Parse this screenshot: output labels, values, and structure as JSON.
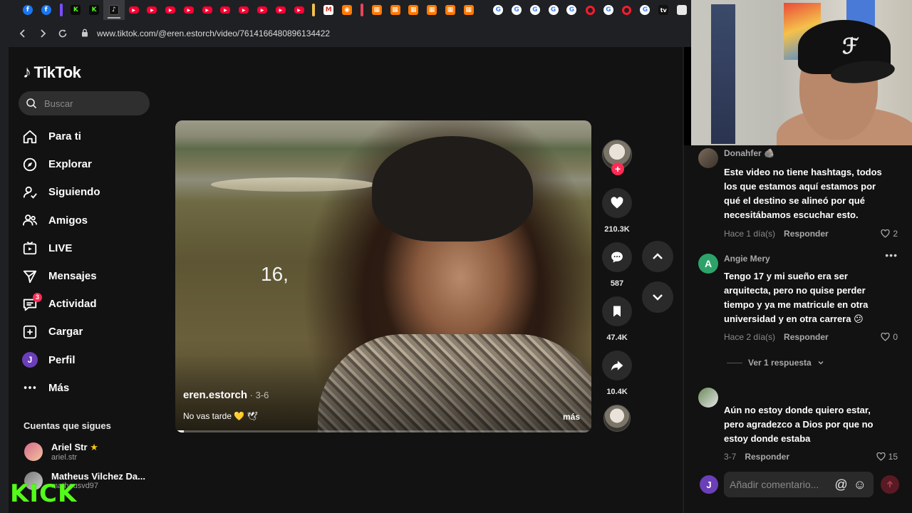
{
  "browser": {
    "url": "www.tiktok.com/@eren.estorch/video/7614166480896134422",
    "active_tab_label": "N"
  },
  "tiktok": {
    "logo_text": "TikTok",
    "search_placeholder": "Buscar",
    "nav": [
      {
        "label": "Para ti",
        "icon": "home-icon"
      },
      {
        "label": "Explorar",
        "icon": "compass-icon"
      },
      {
        "label": "Siguiendo",
        "icon": "following-icon"
      },
      {
        "label": "Amigos",
        "icon": "friends-icon"
      },
      {
        "label": "LIVE",
        "icon": "live-icon"
      },
      {
        "label": "Mensajes",
        "icon": "send-icon"
      },
      {
        "label": "Actividad",
        "icon": "inbox-icon",
        "badge": "3"
      },
      {
        "label": "Cargar",
        "icon": "upload-icon"
      },
      {
        "label": "Perfil",
        "icon": "profile-avatar",
        "avatar_letter": "J"
      },
      {
        "label": "Más",
        "icon": "more-icon"
      }
    ],
    "following_title": "Cuentas que sigues",
    "following": [
      {
        "name": "Ariel Str",
        "handle": "ariel.str",
        "verified_star": "★"
      },
      {
        "name": "Matheus Vilchez Da...",
        "handle": "matheusvd97"
      }
    ]
  },
  "video": {
    "overlay_number": "16,",
    "username": "eren.estorch",
    "date": " · 3-6",
    "caption": "No vas tarde 💛 🕊",
    "more_label": "más",
    "progress_fraction": 0.02
  },
  "actions": {
    "likes": "210.3K",
    "comments": "587",
    "saves": "47.4K",
    "shares": "10.4K"
  },
  "comments": [
    {
      "name": "Donahfer 🪨",
      "text": "Este video no tiene hashtags, todos los que estamos aquí estamos por qué el destino se alineó por qué necesitábamos escuchar esto.",
      "time": "Hace 1 día(s)",
      "reply_label": "Responder",
      "likes": "2"
    },
    {
      "name": "Angie Mery",
      "avatar_letter": "A",
      "text": "Tengo 17 y mi sueño era ser arquitecta, pero no quise perder tiempo y ya me matricule en otra universidad y en otra carrera 😕",
      "time": "Hace 2 día(s)",
      "reply_label": "Responder",
      "likes": "0",
      "view_replies": "Ver 1 respuesta"
    },
    {
      "name": "",
      "text": "Aún no estoy donde quiero estar, pero agradezco a Dios por que no estoy donde estaba",
      "time": "3-7",
      "reply_label": "Responder",
      "likes": "15"
    }
  ],
  "comment_box": {
    "avatar_letter": "J",
    "placeholder": "Añadir comentario...",
    "mention_icon": "@",
    "emoji_icon": "☺"
  },
  "overlay": {
    "kick_text": "KICK"
  },
  "colors": {
    "accent": "#fe2c55",
    "kick_green": "#53fc18",
    "background": "#121212"
  }
}
